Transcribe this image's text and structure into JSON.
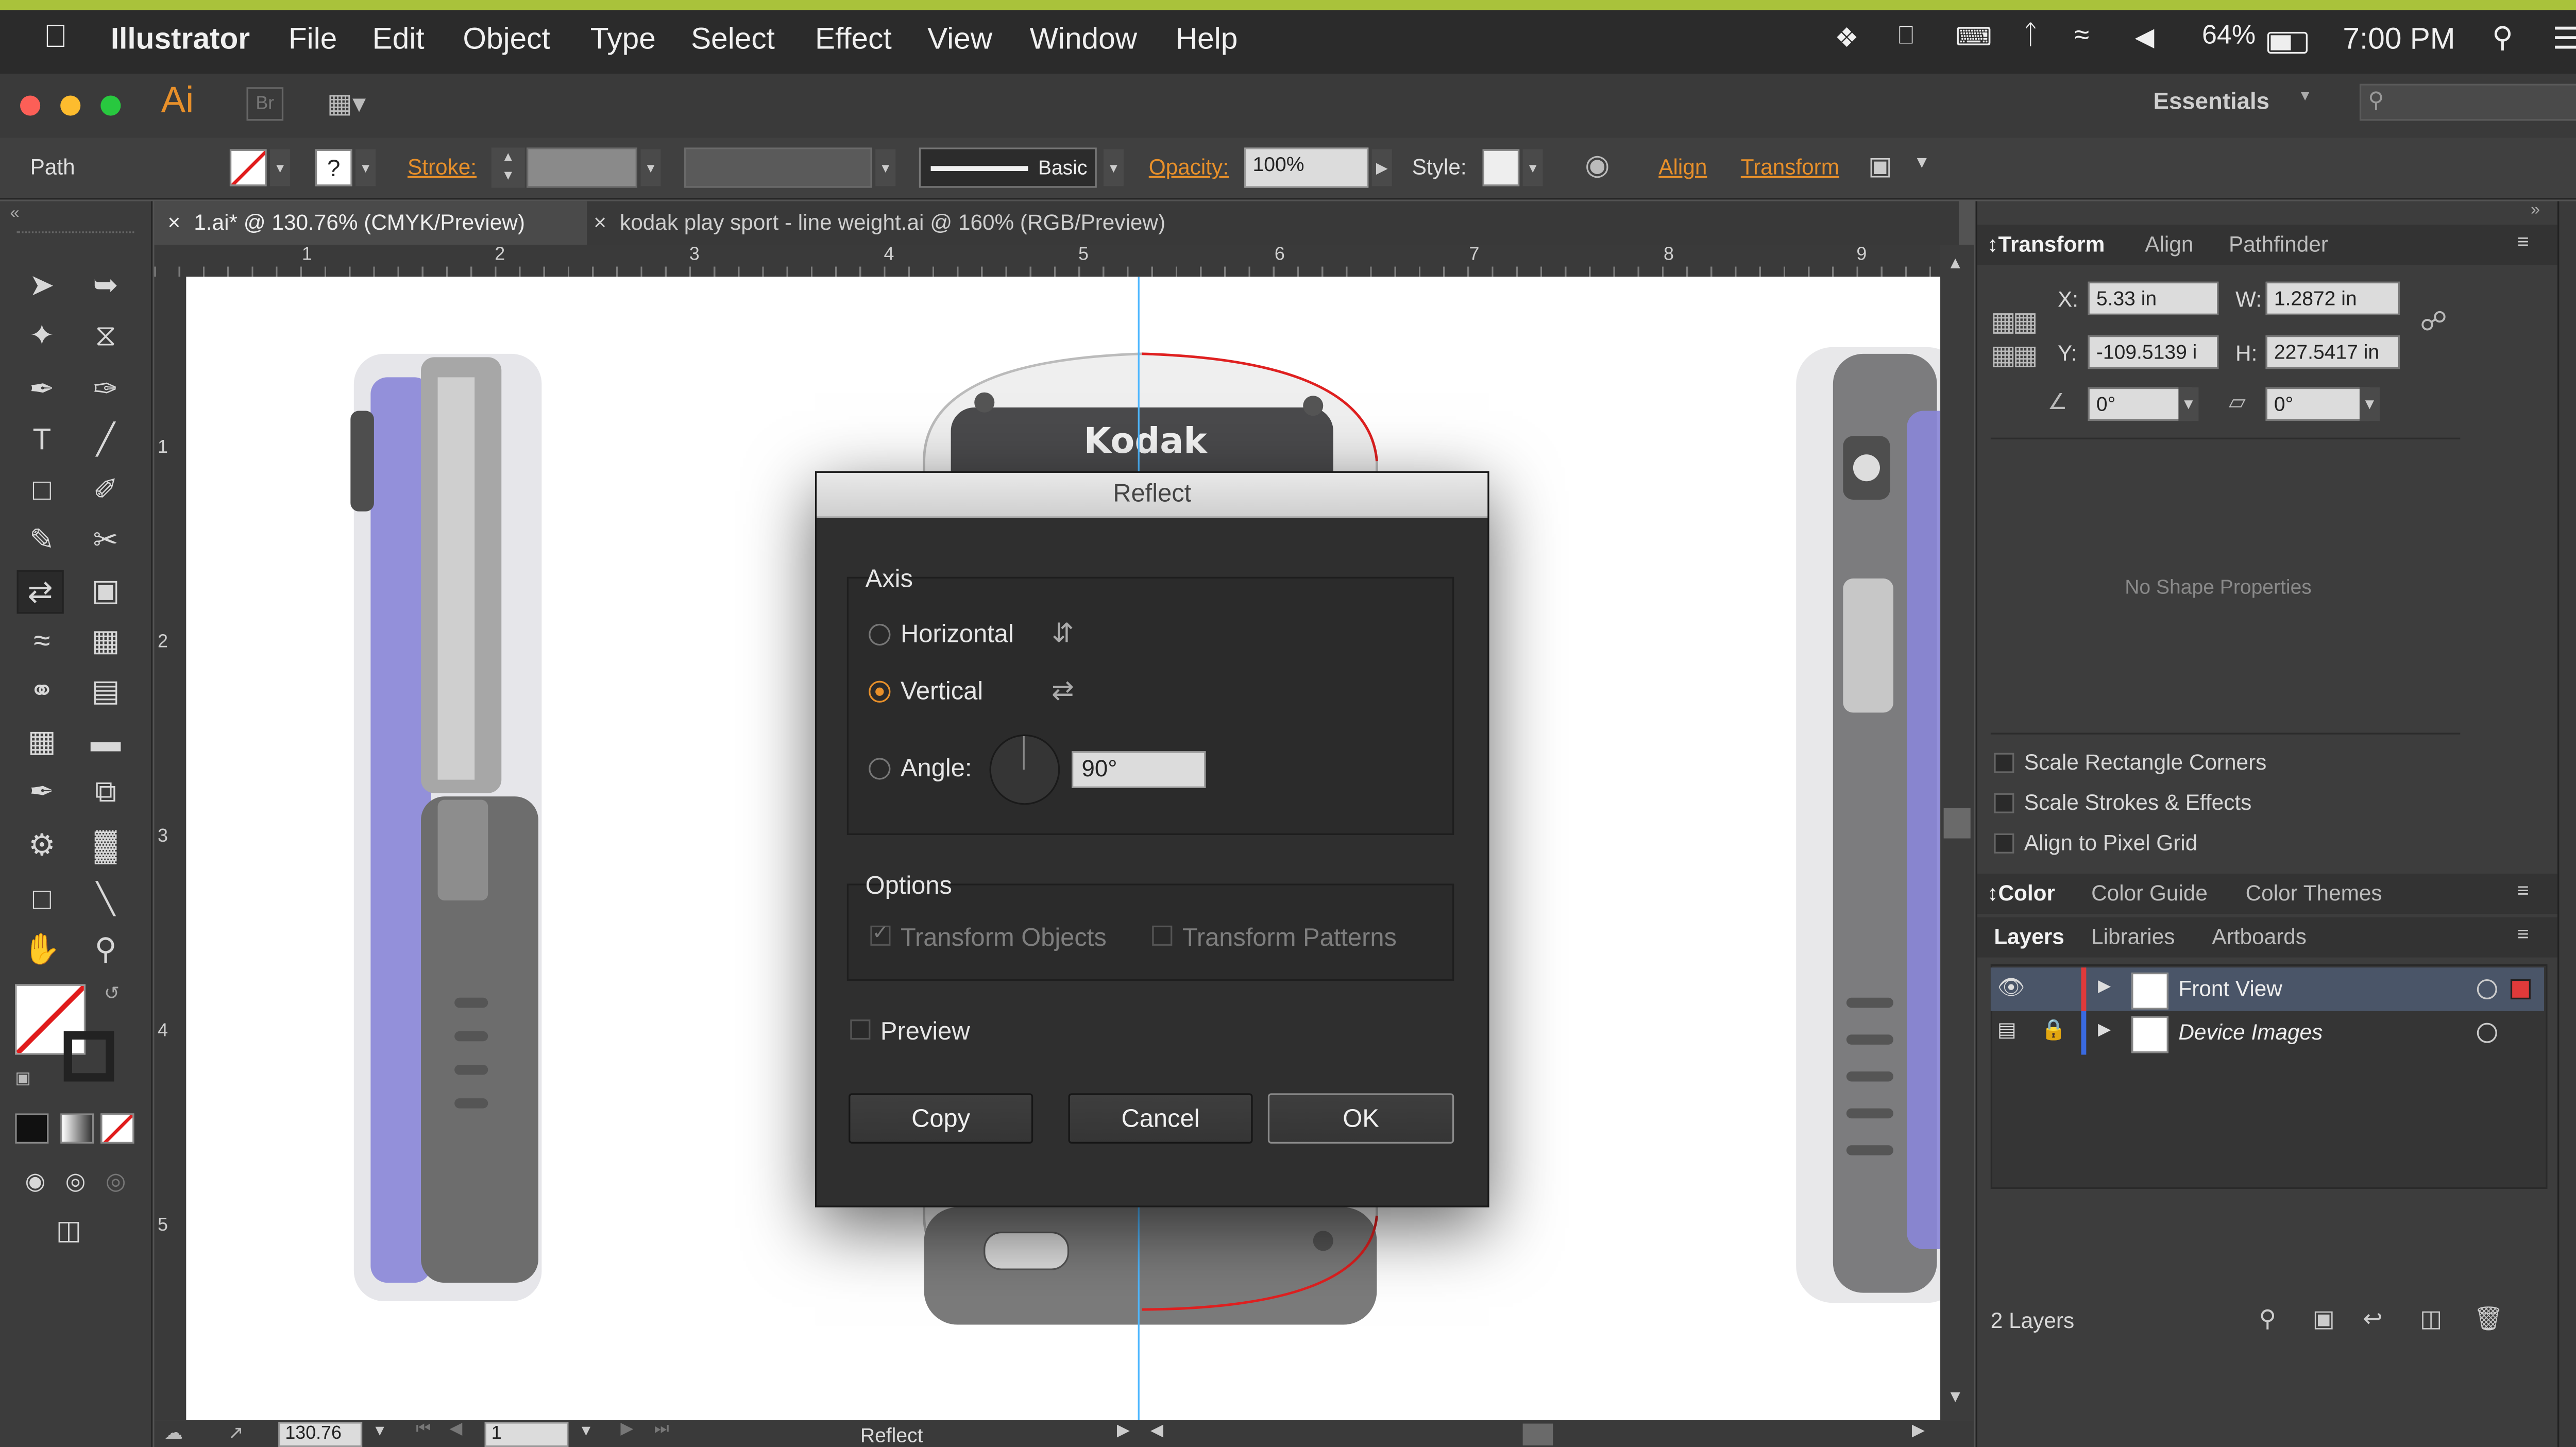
{
  "menubar": {
    "apple": "",
    "app": "Illustrator",
    "items": [
      "File",
      "Edit",
      "Object",
      "Type",
      "Select",
      "Effect",
      "View",
      "Window",
      "Help"
    ],
    "battery": "64%",
    "time": "7:00 PM"
  },
  "appbar": {
    "logo": "Ai",
    "bridge": "Br",
    "workspace": "Essentials",
    "search_placeholder": ""
  },
  "controlbar": {
    "selection": "Path",
    "stroke_label": "Stroke:",
    "brush": "Basic",
    "opacity_label": "Opacity:",
    "opacity_value": "100%",
    "style_label": "Style:",
    "align": "Align",
    "transform": "Transform"
  },
  "tabs": [
    {
      "label": "1.ai* @ 130.76% (CMYK/Preview)"
    },
    {
      "label": "kodak play sport - line weight.ai @ 160% (RGB/Preview)"
    }
  ],
  "rulers": {
    "h": [
      "1",
      "2",
      "3",
      "4",
      "5",
      "6",
      "7",
      "8",
      "9"
    ],
    "v": [
      "1",
      "2",
      "3",
      "4",
      "5"
    ]
  },
  "status": {
    "zoom": "130.76",
    "artboard": "1",
    "tool": "Reflect"
  },
  "dialog": {
    "title": "Reflect",
    "axis_title": "Axis",
    "horizontal": "Horizontal",
    "vertical": "Vertical",
    "selected_axis": "Vertical",
    "angle_label": "Angle:",
    "angle_value": "90°",
    "options_title": "Options",
    "transform_objects": "Transform Objects",
    "transform_patterns": "Transform Patterns",
    "preview": "Preview",
    "copy": "Copy",
    "cancel": "Cancel",
    "ok": "OK"
  },
  "canvas": {
    "brand": "Kodak"
  },
  "transform_panel": {
    "tabs": [
      "Transform",
      "Align",
      "Pathfinder"
    ],
    "x_label": "X:",
    "x": "5.33 in",
    "y_label": "Y:",
    "y": "-109.5139 i",
    "w_label": "W:",
    "w": "1.2872 in",
    "h_label": "H:",
    "h": "227.5417 in",
    "rotate": "0°",
    "shear": "0°",
    "no_shape": "No Shape Properties",
    "options": [
      "Scale Rectangle Corners",
      "Scale Strokes & Effects",
      "Align to Pixel Grid"
    ]
  },
  "color_panel": {
    "tabs": [
      "Color",
      "Color Guide",
      "Color Themes"
    ]
  },
  "layers_panel": {
    "tabs": [
      "Layers",
      "Libraries",
      "Artboards"
    ],
    "layers": [
      {
        "name": "Front View",
        "color": "#e03a3a"
      },
      {
        "name": "Device Images",
        "color": "#3a6ae0"
      }
    ],
    "count": "2 Layers"
  },
  "colors": {
    "accent": "#e8902a",
    "device_purple": "#8a86d8",
    "guide": "#4fb7ff",
    "path": "#e02020"
  }
}
